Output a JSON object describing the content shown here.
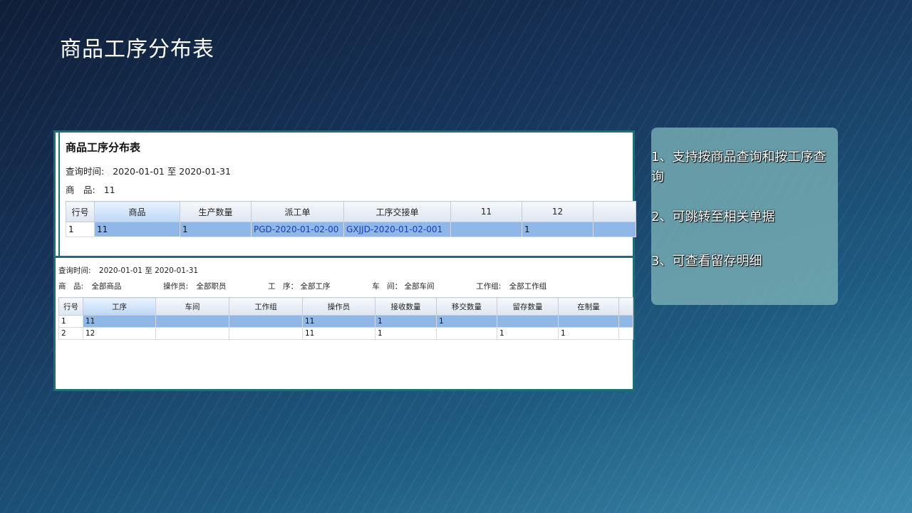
{
  "slide": {
    "title": "商品工序分布表"
  },
  "report_top": {
    "title": "商品工序分布表",
    "query_time_label": "查询时间:",
    "query_time_value": "2020-01-01 至 2020-01-31",
    "product_label": "商　品:",
    "product_value": "11",
    "table": {
      "headers": [
        "行号",
        "商品",
        "生产数量",
        "派工单",
        "工序交接单",
        "11",
        "12",
        ""
      ],
      "rows": [
        [
          "1",
          "11",
          "1",
          "PGD-2020-01-02-00",
          "GXJJD-2020-01-02-001",
          "",
          "1",
          ""
        ]
      ]
    }
  },
  "report_bottom": {
    "query_time_label": "查询时间:",
    "query_time_value": "2020-01-01 至 2020-01-31",
    "filters": [
      {
        "label": "商　品:",
        "value": "全部商品"
      },
      {
        "label": "操作员:",
        "value": "全部职员"
      },
      {
        "label": "工　序：",
        "value": "全部工序"
      },
      {
        "label": "车　间：",
        "value": "全部车间"
      },
      {
        "label": "工作组:",
        "value": "全部工作组"
      }
    ],
    "table": {
      "headers": [
        "行号",
        "工序",
        "车间",
        "工作组",
        "操作员",
        "接收数量",
        "移交数量",
        "留存数量",
        "在制量",
        ""
      ],
      "rows": [
        [
          "1",
          "11",
          "",
          "",
          "11",
          "1",
          "1",
          "",
          "",
          ""
        ],
        [
          "2",
          "12",
          "",
          "",
          "11",
          "1",
          "",
          "1",
          "1",
          ""
        ]
      ]
    }
  },
  "features": [
    "1、支持按商品查询和按工序查询",
    "2、可跳转至相关单据",
    "3、可查看留存明细"
  ]
}
